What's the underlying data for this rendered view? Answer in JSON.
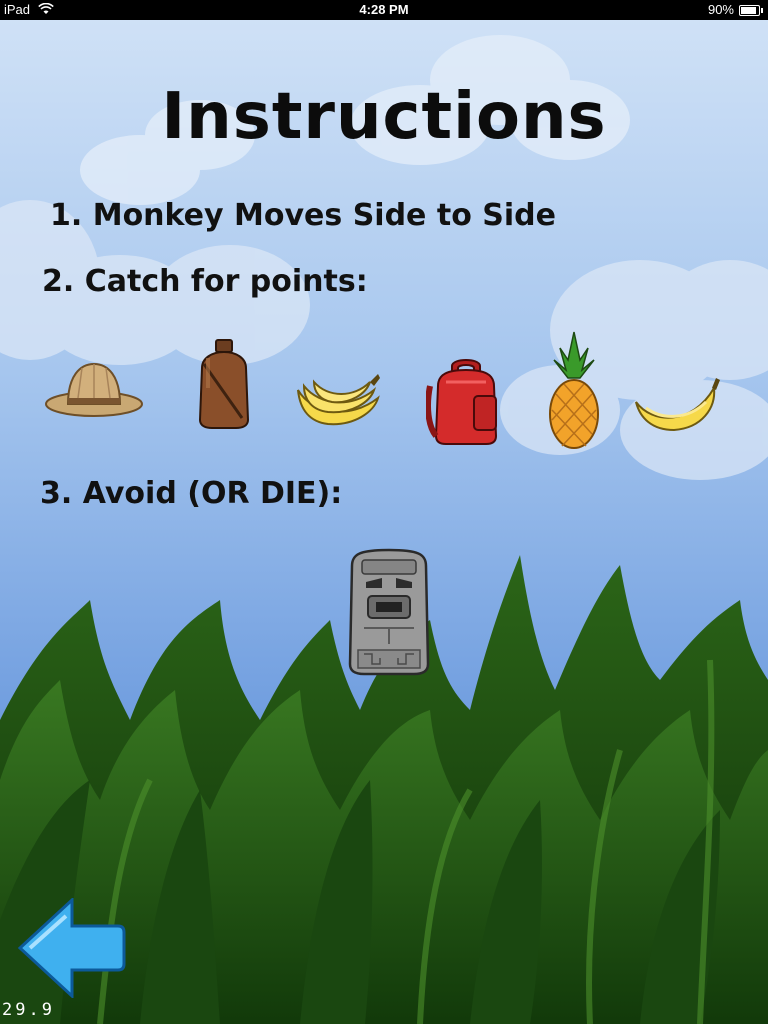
{
  "status_bar": {
    "device": "iPad",
    "time": "4:28 PM",
    "battery": "90%",
    "battery_level": 0.9
  },
  "title": "Instructions",
  "steps": {
    "step1": "1. Monkey Moves Side to Side",
    "step2": "2. Catch for points:",
    "step3": "3. Avoid (OR DIE):"
  },
  "catch_items": [
    "safari-hat",
    "canteen",
    "banana-bunch",
    "backpack",
    "pineapple",
    "banana"
  ],
  "avoid_items": [
    "stone-idol"
  ],
  "fps": "29.9",
  "back_icon": "back-arrow-icon",
  "colors": {
    "sky_top": "#c8ddf4",
    "sky_bottom": "#5d8fd6",
    "grass": "#1d4d12",
    "arrow": "#3fb0ef"
  }
}
